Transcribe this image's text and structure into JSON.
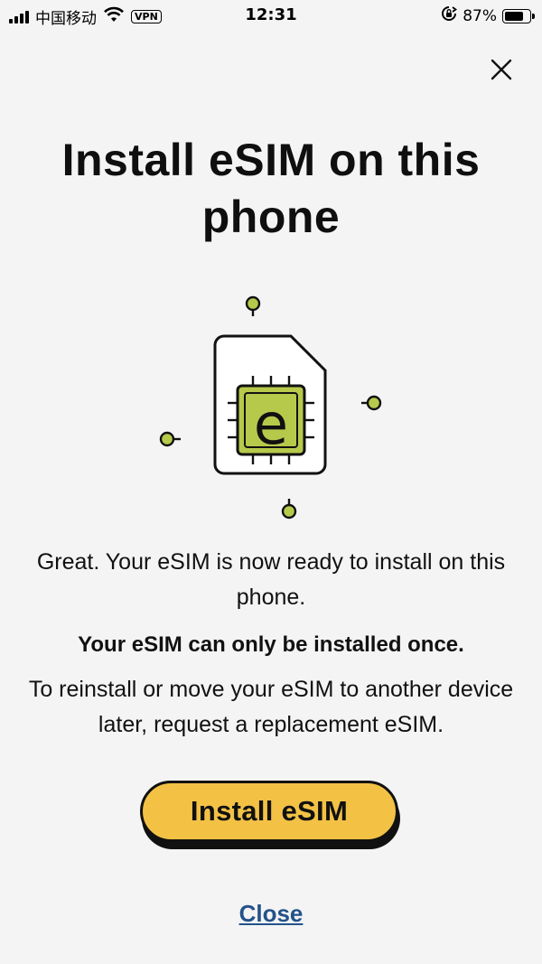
{
  "status_bar": {
    "carrier": "中国移动",
    "vpn": "VPN",
    "time": "12:31",
    "battery": "87%",
    "battery_level": 0.87
  },
  "modal": {
    "title": "Install eSIM on this phone",
    "illustration_letter": "e",
    "paragraph_ready": "Great. Your eSIM is now ready to install on this phone.",
    "paragraph_once": "Your eSIM can only be installed once.",
    "paragraph_reinstall": "To reinstall or move your eSIM to another device later, request a replacement eSIM.",
    "install_button": "Install eSIM",
    "close_link": "Close"
  },
  "colors": {
    "background": "#f4f4f4",
    "button_yellow": "#f3c245",
    "chip_green": "#b7c94b",
    "link_blue": "#24528a"
  }
}
